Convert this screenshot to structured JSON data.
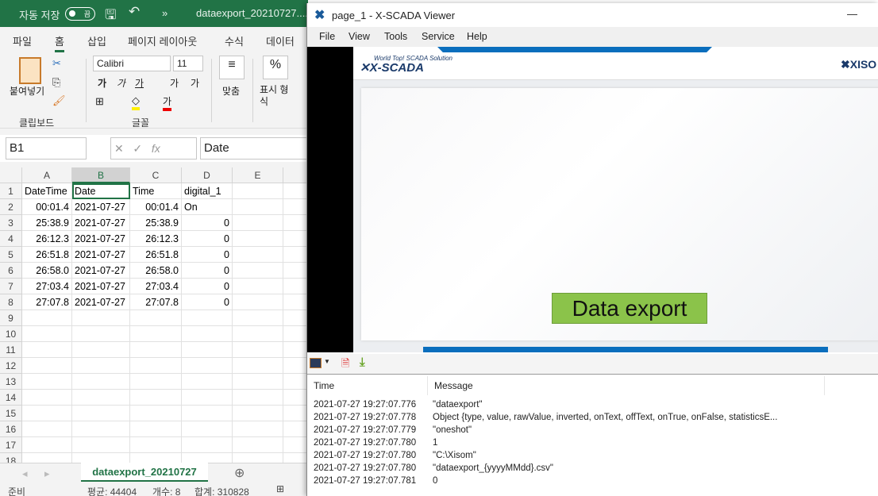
{
  "excel": {
    "autosave_label": "자동 저장",
    "autosave_state": "끔",
    "filename": "dataexport_20210727....",
    "tabs": [
      "파일",
      "홈",
      "삽입",
      "페이지 레이아웃",
      "수식",
      "데이터"
    ],
    "ribbon": {
      "paste": "붙여넣기",
      "clipboard_group": "클립보드",
      "font_name": "Calibri",
      "font_size": "11",
      "font_group": "글꼴",
      "bold": "가",
      "italic": "가",
      "underline": "가",
      "grow": "가",
      "shrink": "가",
      "font_color": "가",
      "align": "맞춤",
      "number_format": "표시 형식",
      "percent": "%"
    },
    "name_box": "B1",
    "formula_value": "Date",
    "fx": "fx",
    "columns": [
      "A",
      "B",
      "C",
      "D",
      "E"
    ],
    "rows": [
      [
        "DateTime",
        "Date",
        "Time",
        "digital_1"
      ],
      [
        "00:01.4",
        "2021-07-27",
        "00:01.4",
        "On"
      ],
      [
        "25:38.9",
        "2021-07-27",
        "25:38.9",
        "0"
      ],
      [
        "26:12.3",
        "2021-07-27",
        "26:12.3",
        "0"
      ],
      [
        "26:51.8",
        "2021-07-27",
        "26:51.8",
        "0"
      ],
      [
        "26:58.0",
        "2021-07-27",
        "26:58.0",
        "0"
      ],
      [
        "27:03.4",
        "2021-07-27",
        "27:03.4",
        "0"
      ],
      [
        "27:07.8",
        "2021-07-27",
        "27:07.8",
        "0"
      ]
    ],
    "row_numbers": [
      "1",
      "2",
      "3",
      "4",
      "5",
      "6",
      "7",
      "8",
      "9",
      "10",
      "11",
      "12",
      "13",
      "14",
      "15",
      "16",
      "17",
      "18"
    ],
    "sheet_tab": "dataexport_20210727",
    "status": {
      "ready": "준비",
      "average": "평균: 44404",
      "count": "개수: 8",
      "sum": "합계: 310828"
    },
    "accent": "#217346"
  },
  "viewer": {
    "title": "page_1 - X-SCADA Viewer",
    "minimize": "—",
    "menu": [
      "File",
      "View",
      "Tools",
      "Service",
      "Help"
    ],
    "logo": "X-SCADA",
    "logo_tagline": "World Top! SCADA Solution",
    "brand_right": "XISO",
    "export_button": "Data export",
    "log": {
      "headers": [
        "Time",
        "Message"
      ],
      "rows": [
        [
          "2021-07-27 19:27:07.776",
          "\"dataexport\""
        ],
        [
          "2021-07-27 19:27:07.778",
          "Object {type, value, rawValue, inverted, onText, offText, onTrue, onFalse, statisticsE..."
        ],
        [
          "2021-07-27 19:27:07.779",
          "\"oneshot\""
        ],
        [
          "2021-07-27 19:27:07.780",
          "1"
        ],
        [
          "2021-07-27 19:27:07.780",
          "\"C:\\Xisom\""
        ],
        [
          "2021-07-27 19:27:07.780",
          "\"dataexport_{yyyyMMdd}.csv\""
        ],
        [
          "2021-07-27 19:27:07.781",
          "0"
        ]
      ]
    },
    "button_color": "#8bc34a",
    "brand_blue": "#0a6ebd"
  }
}
